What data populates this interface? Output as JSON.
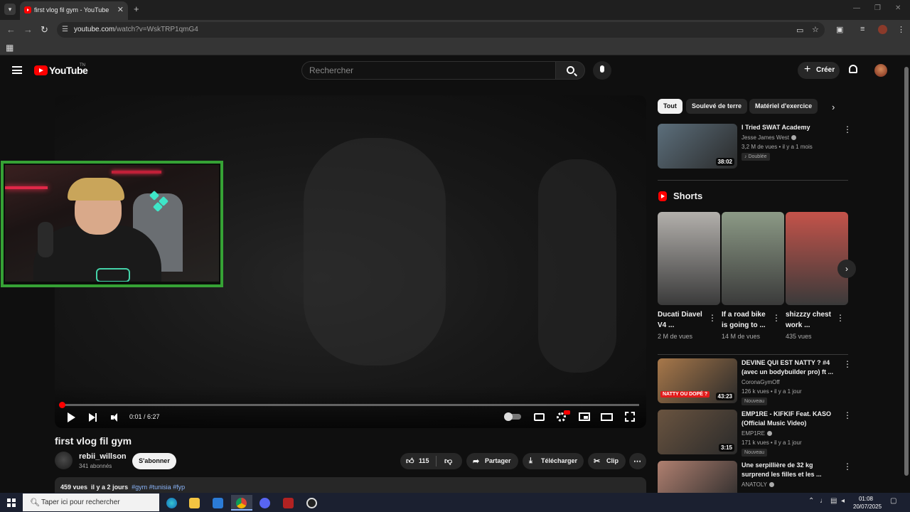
{
  "browser": {
    "tab_title": "first vlog fil gym - YouTube",
    "url_host": "youtube.com",
    "url_path": "/watch?v=WskTRP1qmG4"
  },
  "youtube": {
    "logo_text": "YouTube",
    "country_code": "TN",
    "search_placeholder": "Rechercher",
    "create_label": "Créer"
  },
  "player": {
    "time_current": "0:01",
    "time_total": "6:27",
    "progress_fraction": 0.003
  },
  "video": {
    "title": "first vlog fil gym",
    "channel": "rebii_willson",
    "subscribers": "341 abonnés",
    "subscribe_label": "S'abonner",
    "likes": "115",
    "share_label": "Partager",
    "download_label": "Télécharger",
    "clip_label": "Clip",
    "views": "459 vues",
    "age": "il y a 2 jours",
    "tags": "#gym #tunisia #fyp"
  },
  "chips": [
    {
      "label": "Tout",
      "active": true
    },
    {
      "label": "Soulevé de terre",
      "active": false
    },
    {
      "label": "Matériel d'exercice",
      "active": false
    }
  ],
  "related": [
    {
      "title": "I Tried SWAT Academy",
      "channel": "Jesse James West",
      "meta": "3,2 M de vues • il y a 1 mois",
      "badge": "Doublée",
      "duration": "38:02",
      "thumb_color": "#5c6f7c"
    },
    {
      "title": "DEVINE QUI EST NATTY ? #4 (avec un bodybuilder pro) ft ...",
      "channel": "CoronaGymOff",
      "meta": "126 k vues • il y a 1 jour",
      "badge": "Nouveau",
      "duration": "43:23",
      "thumb_label": "NATTY OU DOPÉ ?",
      "thumb_color": "#a8784a"
    },
    {
      "title": "EMP1RE - KIFKIF Feat. KASO (Official Music Video)",
      "channel": "EMP1RE",
      "meta": "171 k vues • il y a 1 jour",
      "badge": "Nouveau",
      "duration": "3:15",
      "thumb_color": "#6a5440"
    },
    {
      "title": "Une serpillière de 32 kg surprend les filles et les ...",
      "channel": "ANATOLY",
      "meta": "",
      "badge": "",
      "duration": "",
      "thumb_color": "#b08070"
    }
  ],
  "shorts": {
    "heading": "Shorts",
    "items": [
      {
        "title": "Ducati Diavel V4 ...",
        "views": "2 M de vues",
        "thumb_color": "#b3b0ac"
      },
      {
        "title": "If a road bike is going to ...",
        "views": "14 M de vues",
        "thumb_color": "#8c9a86"
      },
      {
        "title": "shizzzy chest work ...",
        "views": "435 vues",
        "thumb_color": "#c4534a"
      }
    ]
  },
  "taskbar": {
    "search_placeholder": "Taper ici pour rechercher",
    "time": "01:08",
    "date": "20/07/2025"
  },
  "colors": {
    "yt_red": "#ff0000",
    "background": "#0f0f0f",
    "webcam_frame": "#36a235"
  }
}
